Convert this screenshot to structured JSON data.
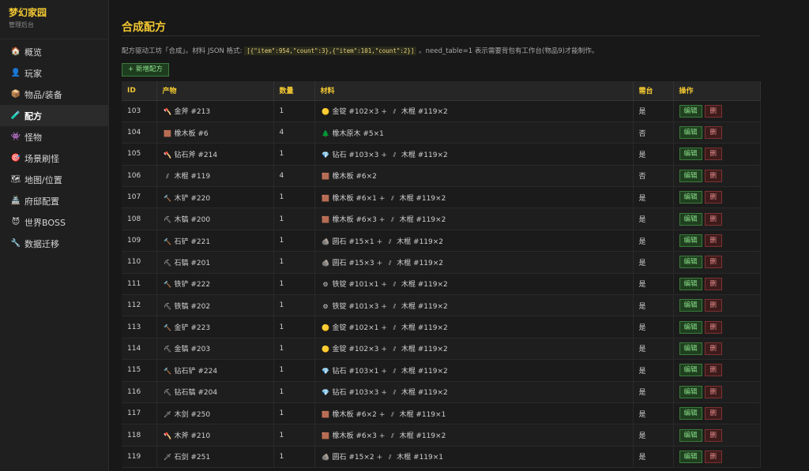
{
  "brand": {
    "title": "梦幻家园",
    "subtitle": "管理后台"
  },
  "colors": {
    "accent": "#f2c832",
    "edit": "#8be08b",
    "delete": "#e38b8b"
  },
  "nav": [
    {
      "label": "概览",
      "icon": "house-icon",
      "glyph": "🏠",
      "active": false
    },
    {
      "label": "玩家",
      "icon": "player-icon",
      "glyph": "👤",
      "active": false
    },
    {
      "label": "物品/装备",
      "icon": "box-icon",
      "glyph": "📦",
      "active": false
    },
    {
      "label": "配方",
      "icon": "recipe-icon",
      "glyph": "🧪",
      "active": true
    },
    {
      "label": "怪物",
      "icon": "monster-icon",
      "glyph": "👾",
      "active": false
    },
    {
      "label": "场景刷怪",
      "icon": "target-icon",
      "glyph": "🎯",
      "active": false
    },
    {
      "label": "地图/位置",
      "icon": "map-icon",
      "glyph": "🗺",
      "active": false
    },
    {
      "label": "府邸配置",
      "icon": "mansion-icon",
      "glyph": "🏯",
      "active": false
    },
    {
      "label": "世界BOSS",
      "icon": "demon-icon",
      "glyph": "😈",
      "active": false
    },
    {
      "label": "数据迁移",
      "icon": "wrench-icon",
      "glyph": "🔧",
      "active": false
    }
  ],
  "page": {
    "title": "合成配方",
    "desc_before": "配方驱动工坊「合成」。材料 JSON 格式:",
    "desc_code": "[{\"item\":954,\"count\":3},{\"item\":101,\"count\":2}]",
    "desc_after": "。need_table=1 表示需要背包有工作台(物品9)才能制作。",
    "add_button": "+ 新增配方"
  },
  "table": {
    "headers": {
      "id": "ID",
      "product": "产物",
      "qty": "数量",
      "materials": "材料",
      "table": "需台",
      "actions": "操作"
    },
    "edit_label": "编辑",
    "delete_label": "删",
    "rows": [
      {
        "id": "103",
        "product": {
          "glyph": "🪓",
          "icon": "axe-icon",
          "text": "金斧 #213"
        },
        "qty": "1",
        "materials": [
          {
            "glyph": "🟡",
            "icon": "gold-ingot-icon",
            "text": "金锭 #102×3"
          },
          {
            "glyph": "⫽",
            "icon": "stick-icon",
            "text": "木棍 #119×2"
          }
        ],
        "table": "是"
      },
      {
        "id": "104",
        "product": {
          "glyph": "🟫",
          "icon": "plank-icon",
          "text": "橡木板 #6"
        },
        "qty": "4",
        "materials": [
          {
            "glyph": "🌲",
            "icon": "tree-icon",
            "text": "橡木原木 #5×1"
          }
        ],
        "table": "否"
      },
      {
        "id": "105",
        "product": {
          "glyph": "🪓",
          "icon": "axe-icon",
          "text": "钻石斧 #214"
        },
        "qty": "1",
        "materials": [
          {
            "glyph": "💎",
            "icon": "diamond-icon",
            "text": "钻石 #103×3"
          },
          {
            "glyph": "⫽",
            "icon": "stick-icon",
            "text": "木棍 #119×2"
          }
        ],
        "table": "是"
      },
      {
        "id": "106",
        "product": {
          "glyph": "⫽",
          "icon": "stick-icon",
          "text": "木棍 #119"
        },
        "qty": "4",
        "materials": [
          {
            "glyph": "🟫",
            "icon": "plank-icon",
            "text": "橡木板 #6×2"
          }
        ],
        "table": "否"
      },
      {
        "id": "107",
        "product": {
          "glyph": "🔨",
          "icon": "shovel-icon",
          "text": "木铲 #220"
        },
        "qty": "1",
        "materials": [
          {
            "glyph": "🟫",
            "icon": "plank-icon",
            "text": "橡木板 #6×1"
          },
          {
            "glyph": "⫽",
            "icon": "stick-icon",
            "text": "木棍 #119×2"
          }
        ],
        "table": "是"
      },
      {
        "id": "108",
        "product": {
          "glyph": "⛏",
          "icon": "pickaxe-icon",
          "text": "木镐 #200"
        },
        "qty": "1",
        "materials": [
          {
            "glyph": "🟫",
            "icon": "plank-icon",
            "text": "橡木板 #6×3"
          },
          {
            "glyph": "⫽",
            "icon": "stick-icon",
            "text": "木棍 #119×2"
          }
        ],
        "table": "是"
      },
      {
        "id": "109",
        "product": {
          "glyph": "🔨",
          "icon": "shovel-icon",
          "text": "石铲 #221"
        },
        "qty": "1",
        "materials": [
          {
            "glyph": "🪨",
            "icon": "rock-icon",
            "text": "圆石 #15×1"
          },
          {
            "glyph": "⫽",
            "icon": "stick-icon",
            "text": "木棍 #119×2"
          }
        ],
        "table": "是"
      },
      {
        "id": "110",
        "product": {
          "glyph": "⛏",
          "icon": "pickaxe-icon",
          "text": "石镐 #201"
        },
        "qty": "1",
        "materials": [
          {
            "glyph": "🪨",
            "icon": "rock-icon",
            "text": "圆石 #15×3"
          },
          {
            "glyph": "⫽",
            "icon": "stick-icon",
            "text": "木棍 #119×2"
          }
        ],
        "table": "是"
      },
      {
        "id": "111",
        "product": {
          "glyph": "🔨",
          "icon": "shovel-icon",
          "text": "铁铲 #222"
        },
        "qty": "1",
        "materials": [
          {
            "glyph": "⚙",
            "icon": "iron-ingot-icon",
            "text": "铁锭 #101×1"
          },
          {
            "glyph": "⫽",
            "icon": "stick-icon",
            "text": "木棍 #119×2"
          }
        ],
        "table": "是"
      },
      {
        "id": "112",
        "product": {
          "glyph": "⛏",
          "icon": "pickaxe-icon",
          "text": "铁镐 #202"
        },
        "qty": "1",
        "materials": [
          {
            "glyph": "⚙",
            "icon": "iron-ingot-icon",
            "text": "铁锭 #101×3"
          },
          {
            "glyph": "⫽",
            "icon": "stick-icon",
            "text": "木棍 #119×2"
          }
        ],
        "table": "是"
      },
      {
        "id": "113",
        "product": {
          "glyph": "🔨",
          "icon": "shovel-icon",
          "text": "金铲 #223"
        },
        "qty": "1",
        "materials": [
          {
            "glyph": "🟡",
            "icon": "gold-ingot-icon",
            "text": "金锭 #102×1"
          },
          {
            "glyph": "⫽",
            "icon": "stick-icon",
            "text": "木棍 #119×2"
          }
        ],
        "table": "是"
      },
      {
        "id": "114",
        "product": {
          "glyph": "⛏",
          "icon": "pickaxe-icon",
          "text": "金镐 #203"
        },
        "qty": "1",
        "materials": [
          {
            "glyph": "🟡",
            "icon": "gold-ingot-icon",
            "text": "金锭 #102×3"
          },
          {
            "glyph": "⫽",
            "icon": "stick-icon",
            "text": "木棍 #119×2"
          }
        ],
        "table": "是"
      },
      {
        "id": "115",
        "product": {
          "glyph": "🔨",
          "icon": "shovel-icon",
          "text": "钻石铲 #224"
        },
        "qty": "1",
        "materials": [
          {
            "glyph": "💎",
            "icon": "diamond-icon",
            "text": "钻石 #103×1"
          },
          {
            "glyph": "⫽",
            "icon": "stick-icon",
            "text": "木棍 #119×2"
          }
        ],
        "table": "是"
      },
      {
        "id": "116",
        "product": {
          "glyph": "⛏",
          "icon": "pickaxe-icon",
          "text": "钻石镐 #204"
        },
        "qty": "1",
        "materials": [
          {
            "glyph": "💎",
            "icon": "diamond-icon",
            "text": "钻石 #103×3"
          },
          {
            "glyph": "⫽",
            "icon": "stick-icon",
            "text": "木棍 #119×2"
          }
        ],
        "table": "是"
      },
      {
        "id": "117",
        "product": {
          "glyph": "🗡",
          "icon": "sword-icon",
          "text": "木剑 #250"
        },
        "qty": "1",
        "materials": [
          {
            "glyph": "🟫",
            "icon": "plank-icon",
            "text": "橡木板 #6×2"
          },
          {
            "glyph": "⫽",
            "icon": "stick-icon",
            "text": "木棍 #119×1"
          }
        ],
        "table": "是"
      },
      {
        "id": "118",
        "product": {
          "glyph": "🪓",
          "icon": "axe-icon",
          "text": "木斧 #210"
        },
        "qty": "1",
        "materials": [
          {
            "glyph": "🟫",
            "icon": "plank-icon",
            "text": "橡木板 #6×3"
          },
          {
            "glyph": "⫽",
            "icon": "stick-icon",
            "text": "木棍 #119×2"
          }
        ],
        "table": "是"
      },
      {
        "id": "119",
        "product": {
          "glyph": "🗡",
          "icon": "sword-icon",
          "text": "石剑 #251"
        },
        "qty": "1",
        "materials": [
          {
            "glyph": "🪨",
            "icon": "rock-icon",
            "text": "圆石 #15×2"
          },
          {
            "glyph": "⫽",
            "icon": "stick-icon",
            "text": "木棍 #119×1"
          }
        ],
        "table": "是"
      }
    ]
  }
}
